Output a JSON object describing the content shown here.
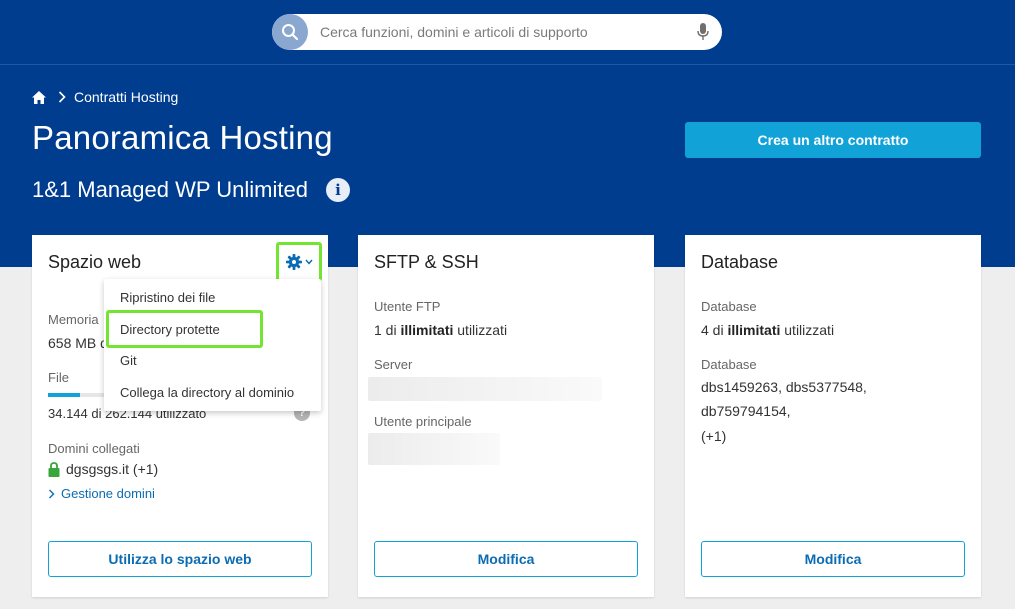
{
  "search": {
    "placeholder": "Cerca funzioni, domini e articoli di supporto",
    "value": ""
  },
  "breadcrumb": {
    "items": [
      "Contratti Hosting"
    ]
  },
  "header": {
    "title": "Panoramica Hosting",
    "subtitle": "1&1 Managed WP Unlimited",
    "create_button": "Crea un altro contratto"
  },
  "cards": {
    "webspace": {
      "title": "Spazio web",
      "memory_label": "Memoria",
      "memory_value": "658 MB d",
      "files_label": "File",
      "files_value": "34.144 di 262.144 utilizzato",
      "files_progress": 0.13,
      "domains_label": "Domini collegati",
      "domain": "dgsgsgs.it (+1)",
      "manage_link": "Gestione domini",
      "button": "Utilizza lo spazio web",
      "help": "?"
    },
    "sftp": {
      "title": "SFTP & SSH",
      "ftp_user_label": "Utente FTP",
      "ftp_prefix": "1 di",
      "ftp_strong": "illimitati",
      "ftp_suffix": "utilizzati",
      "server_label": "Server",
      "main_user_label": "Utente principale",
      "button": "Modifica"
    },
    "database": {
      "title": "Database",
      "db_label": "Database",
      "db_prefix": "4 di",
      "db_strong": "illimitati",
      "db_suffix": "utilizzati",
      "db_list_label": "Database",
      "db_list_line1": "dbs1459263, dbs5377548,",
      "db_list_line2": "db759794154,",
      "db_list_line3": "(+1)",
      "button": "Modifica"
    }
  },
  "dropdown": {
    "items": [
      "Ripristino dei file",
      "Directory protette",
      "Git",
      "Collega la directory al dominio"
    ],
    "highlighted_index": 1
  },
  "colors": {
    "header_bg": "#003d8f",
    "accent": "#11a3d8",
    "link": "#0b6cb3",
    "highlight": "#74e433"
  }
}
